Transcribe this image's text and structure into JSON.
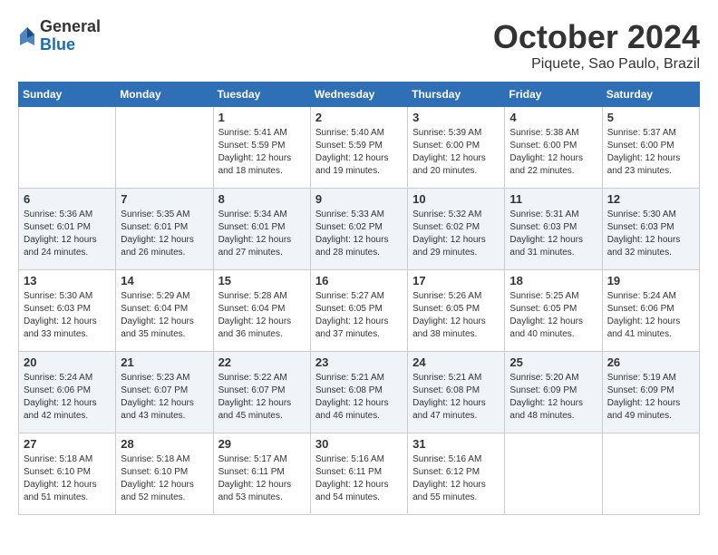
{
  "header": {
    "logo_general": "General",
    "logo_blue": "Blue",
    "month_title": "October 2024",
    "location": "Piquete, Sao Paulo, Brazil"
  },
  "calendar": {
    "days_of_week": [
      "Sunday",
      "Monday",
      "Tuesday",
      "Wednesday",
      "Thursday",
      "Friday",
      "Saturday"
    ],
    "weeks": [
      [
        {
          "day": "",
          "info": ""
        },
        {
          "day": "",
          "info": ""
        },
        {
          "day": "1",
          "info": "Sunrise: 5:41 AM\nSunset: 5:59 PM\nDaylight: 12 hours\nand 18 minutes."
        },
        {
          "day": "2",
          "info": "Sunrise: 5:40 AM\nSunset: 5:59 PM\nDaylight: 12 hours\nand 19 minutes."
        },
        {
          "day": "3",
          "info": "Sunrise: 5:39 AM\nSunset: 6:00 PM\nDaylight: 12 hours\nand 20 minutes."
        },
        {
          "day": "4",
          "info": "Sunrise: 5:38 AM\nSunset: 6:00 PM\nDaylight: 12 hours\nand 22 minutes."
        },
        {
          "day": "5",
          "info": "Sunrise: 5:37 AM\nSunset: 6:00 PM\nDaylight: 12 hours\nand 23 minutes."
        }
      ],
      [
        {
          "day": "6",
          "info": "Sunrise: 5:36 AM\nSunset: 6:01 PM\nDaylight: 12 hours\nand 24 minutes."
        },
        {
          "day": "7",
          "info": "Sunrise: 5:35 AM\nSunset: 6:01 PM\nDaylight: 12 hours\nand 26 minutes."
        },
        {
          "day": "8",
          "info": "Sunrise: 5:34 AM\nSunset: 6:01 PM\nDaylight: 12 hours\nand 27 minutes."
        },
        {
          "day": "9",
          "info": "Sunrise: 5:33 AM\nSunset: 6:02 PM\nDaylight: 12 hours\nand 28 minutes."
        },
        {
          "day": "10",
          "info": "Sunrise: 5:32 AM\nSunset: 6:02 PM\nDaylight: 12 hours\nand 29 minutes."
        },
        {
          "day": "11",
          "info": "Sunrise: 5:31 AM\nSunset: 6:03 PM\nDaylight: 12 hours\nand 31 minutes."
        },
        {
          "day": "12",
          "info": "Sunrise: 5:30 AM\nSunset: 6:03 PM\nDaylight: 12 hours\nand 32 minutes."
        }
      ],
      [
        {
          "day": "13",
          "info": "Sunrise: 5:30 AM\nSunset: 6:03 PM\nDaylight: 12 hours\nand 33 minutes."
        },
        {
          "day": "14",
          "info": "Sunrise: 5:29 AM\nSunset: 6:04 PM\nDaylight: 12 hours\nand 35 minutes."
        },
        {
          "day": "15",
          "info": "Sunrise: 5:28 AM\nSunset: 6:04 PM\nDaylight: 12 hours\nand 36 minutes."
        },
        {
          "day": "16",
          "info": "Sunrise: 5:27 AM\nSunset: 6:05 PM\nDaylight: 12 hours\nand 37 minutes."
        },
        {
          "day": "17",
          "info": "Sunrise: 5:26 AM\nSunset: 6:05 PM\nDaylight: 12 hours\nand 38 minutes."
        },
        {
          "day": "18",
          "info": "Sunrise: 5:25 AM\nSunset: 6:05 PM\nDaylight: 12 hours\nand 40 minutes."
        },
        {
          "day": "19",
          "info": "Sunrise: 5:24 AM\nSunset: 6:06 PM\nDaylight: 12 hours\nand 41 minutes."
        }
      ],
      [
        {
          "day": "20",
          "info": "Sunrise: 5:24 AM\nSunset: 6:06 PM\nDaylight: 12 hours\nand 42 minutes."
        },
        {
          "day": "21",
          "info": "Sunrise: 5:23 AM\nSunset: 6:07 PM\nDaylight: 12 hours\nand 43 minutes."
        },
        {
          "day": "22",
          "info": "Sunrise: 5:22 AM\nSunset: 6:07 PM\nDaylight: 12 hours\nand 45 minutes."
        },
        {
          "day": "23",
          "info": "Sunrise: 5:21 AM\nSunset: 6:08 PM\nDaylight: 12 hours\nand 46 minutes."
        },
        {
          "day": "24",
          "info": "Sunrise: 5:21 AM\nSunset: 6:08 PM\nDaylight: 12 hours\nand 47 minutes."
        },
        {
          "day": "25",
          "info": "Sunrise: 5:20 AM\nSunset: 6:09 PM\nDaylight: 12 hours\nand 48 minutes."
        },
        {
          "day": "26",
          "info": "Sunrise: 5:19 AM\nSunset: 6:09 PM\nDaylight: 12 hours\nand 49 minutes."
        }
      ],
      [
        {
          "day": "27",
          "info": "Sunrise: 5:18 AM\nSunset: 6:10 PM\nDaylight: 12 hours\nand 51 minutes."
        },
        {
          "day": "28",
          "info": "Sunrise: 5:18 AM\nSunset: 6:10 PM\nDaylight: 12 hours\nand 52 minutes."
        },
        {
          "day": "29",
          "info": "Sunrise: 5:17 AM\nSunset: 6:11 PM\nDaylight: 12 hours\nand 53 minutes."
        },
        {
          "day": "30",
          "info": "Sunrise: 5:16 AM\nSunset: 6:11 PM\nDaylight: 12 hours\nand 54 minutes."
        },
        {
          "day": "31",
          "info": "Sunrise: 5:16 AM\nSunset: 6:12 PM\nDaylight: 12 hours\nand 55 minutes."
        },
        {
          "day": "",
          "info": ""
        },
        {
          "day": "",
          "info": ""
        }
      ]
    ]
  }
}
